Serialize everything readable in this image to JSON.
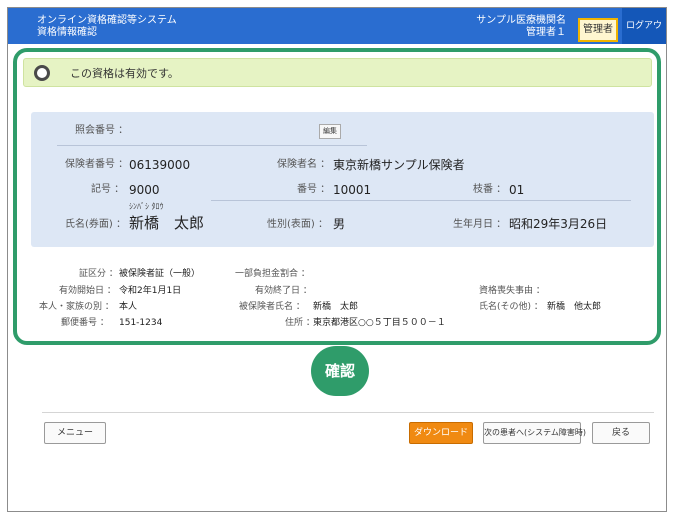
{
  "header": {
    "app_title": "オンライン資格確認等システム",
    "screen_title": "資格情報確認",
    "institution_name": "サンプル医療機関名",
    "user_name": "管理者１",
    "role_badge": "管理者",
    "logout_label": "ログアウト",
    "color": "#2a6dd0"
  },
  "status": {
    "message": "この資格は有効です。",
    "color": "#e6f3c4"
  },
  "qualification": {
    "inquiry_number_label": "照会番号 ：",
    "inquiry_number_value": "",
    "edit_label": "編集",
    "insurer_number_label": "保険者番号 ：",
    "insurer_number_value": "06139000",
    "insurer_name_label": "保険者名 ：",
    "insurer_name_value": "東京新橋サンプル保険者",
    "symbol_label": "記号 ：",
    "symbol_value": "9000",
    "number_label": "番号 ：",
    "number_value": "10001",
    "branch_label": "枝番 ：",
    "branch_value": "01",
    "name_kana": "ｼﾝﾊﾞｼ ﾀﾛｳ",
    "name_label": "氏名(券面) ：",
    "name_value": "新橋　太郎",
    "sex_label": "性別(表面) ：",
    "sex_value": "男",
    "birth_label": "生年月日 ：",
    "birth_value": "昭和29年3月26日"
  },
  "details": {
    "card_type_label": "証区分 ：",
    "card_type_value": "被保険者証（一般）",
    "copay_label": "一部負担金割合 ：",
    "copay_value": "",
    "valid_start_label": "有効開始日 ：",
    "valid_start_value": "令和2年1月1日",
    "valid_end_label": "有効終了日 ：",
    "valid_end_value": "",
    "loss_reason_label": "資格喪失事由 ：",
    "loss_reason_value": "",
    "relation_label": "本人・家族の別 ：",
    "relation_value": "本人",
    "insured_name_label": "被保険者氏名 ：",
    "insured_name_value": "新橋　太郎",
    "other_name_label": "氏名(その他) ：",
    "other_name_value": "新橋　他太郎",
    "postal_label": "郵便番号 ：",
    "postal_value": "151-1234",
    "address_label": "住所 ：",
    "address_value": "東京都港区○○５丁目５００－１"
  },
  "confirm_label": "確認",
  "footer": {
    "menu_label": "メニュー",
    "download_label": "ダウンロード",
    "next_patient_label": "次の患者へ(システム障害時)",
    "back_label": "戻る"
  }
}
